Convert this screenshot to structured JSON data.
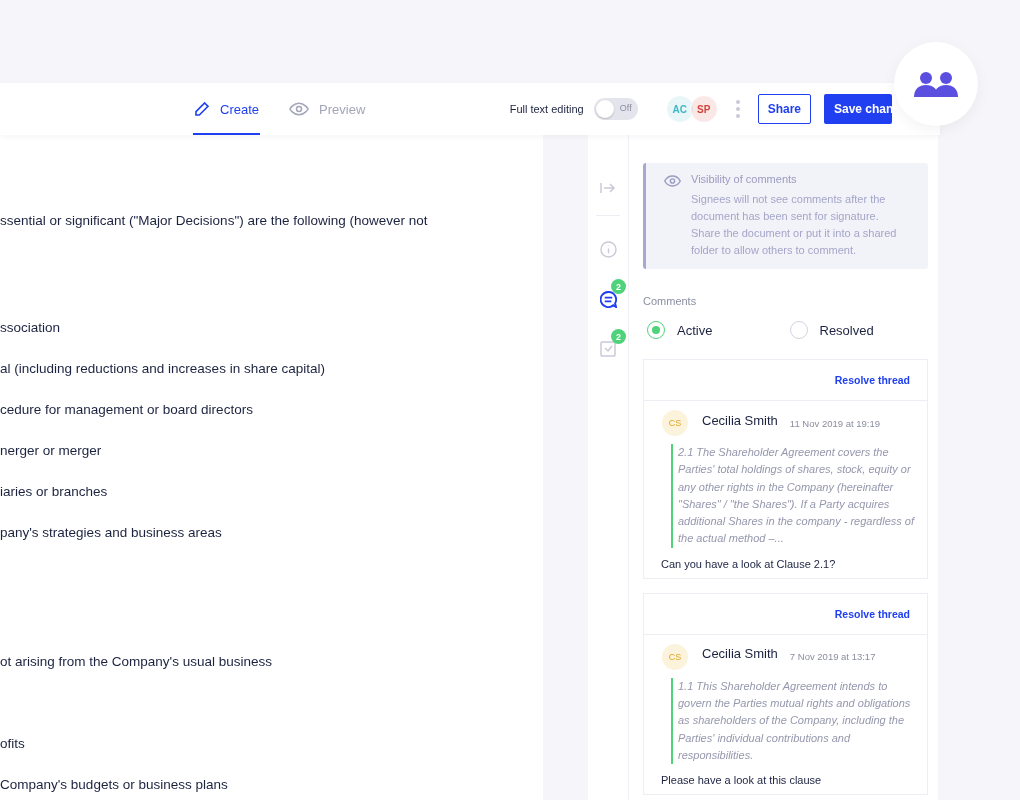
{
  "toolbar": {
    "tabs": [
      {
        "label": "Create",
        "selected": true
      },
      {
        "label": "Preview",
        "selected": false
      }
    ],
    "full_text_editing": {
      "label": "Full text editing",
      "on": false,
      "state_text": "Off"
    },
    "collaborators": [
      {
        "initials": "AC",
        "color": "#3fb8c4"
      },
      {
        "initials": "SP",
        "color": "#d2443a"
      }
    ],
    "share_button": "Share",
    "save_button": "Save chan"
  },
  "document": {
    "sections": [
      [
        "ssential or significant (\"Major Decisions\") are the following (however not"
      ],
      [
        "ssociation",
        "al (including reductions and increases in share capital)",
        "cedure for management or board directors",
        "nerger or merger",
        "iaries or branches",
        "pany's strategies and business areas"
      ],
      [
        "ot arising from the Company's usual business"
      ],
      [
        "ofits",
        "Company's budgets or business plans"
      ]
    ]
  },
  "rail": [
    {
      "selected": false
    },
    {
      "selected": false
    },
    {
      "selected": true,
      "badge": "2"
    },
    {
      "selected": false,
      "badge": "2"
    }
  ],
  "notice": {
    "title": "Visibility of comments",
    "text": "Signees will not see comments after the document has been sent for signature. Share the document or put it into a shared folder to allow others to comment."
  },
  "comments": {
    "label": "Comments",
    "filters": [
      {
        "label": "Active",
        "selected": true
      },
      {
        "label": "Resolved",
        "selected": false
      }
    ],
    "threads": [
      {
        "action": "Resolve thread",
        "initials": "CS",
        "author": "Cecilia Smith",
        "time": "11 Nov 2019 at 19:19",
        "quote": "2.1 The Shareholder Agreement covers the Parties' total holdings of shares, stock, equity or any other rights in the Company (hereinafter \"Shares\" / \"the Shares\"). If a Party acquires additional Shares in the company - regardless of the actual method –...",
        "message": "Can you have a look at Clause 2.1?"
      },
      {
        "action": "Resolve thread",
        "initials": "CS",
        "author": "Cecilia Smith",
        "time": "7 Nov 2019 at 13:17",
        "quote": "1.1 This Shareholder Agreement intends to govern the Parties mutual rights and obligations as shareholders of the Company, including the Parties' individual contributions and responsibilities.",
        "message": "Please have a look at this clause"
      }
    ]
  }
}
